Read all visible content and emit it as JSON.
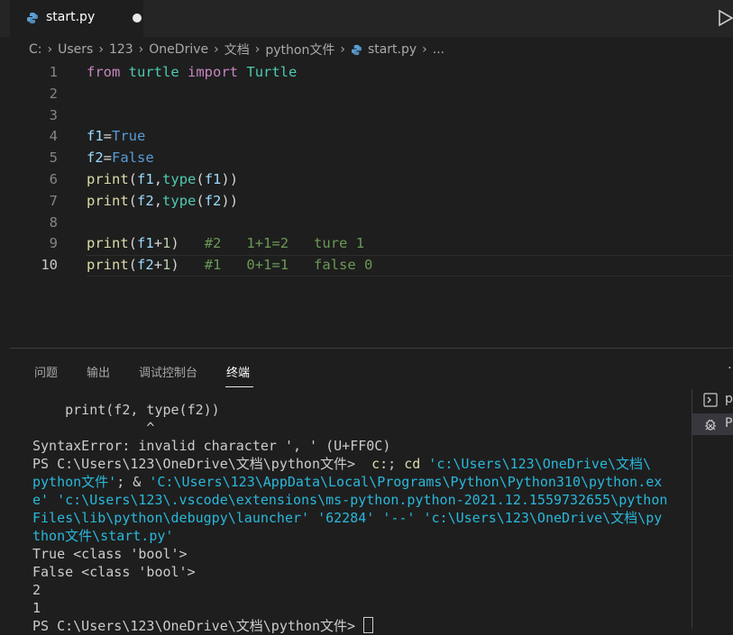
{
  "tab": {
    "filename": "start.py",
    "dirty": true
  },
  "breadcrumb": {
    "items": [
      "C:",
      "Users",
      "123",
      "OneDrive",
      "文档",
      "python文件"
    ],
    "file": "start.py",
    "trail": "..."
  },
  "editor": {
    "lines": [
      {
        "n": "1",
        "tokens": [
          [
            "from",
            "kw"
          ],
          [
            " ",
            "op"
          ],
          [
            "turtle",
            "mod"
          ],
          [
            " ",
            "op"
          ],
          [
            "import",
            "kw"
          ],
          [
            " ",
            "op"
          ],
          [
            "Turtle",
            "cls"
          ]
        ]
      },
      {
        "n": "2",
        "tokens": []
      },
      {
        "n": "3",
        "tokens": []
      },
      {
        "n": "4",
        "tokens": [
          [
            "f1",
            "var"
          ],
          [
            "=",
            "op"
          ],
          [
            "True",
            "const"
          ]
        ]
      },
      {
        "n": "5",
        "tokens": [
          [
            "f2",
            "var"
          ],
          [
            "=",
            "op"
          ],
          [
            "False",
            "const"
          ]
        ]
      },
      {
        "n": "6",
        "tokens": [
          [
            "print",
            "fn"
          ],
          [
            "(",
            "op"
          ],
          [
            "f1",
            "var"
          ],
          [
            ",",
            "op"
          ],
          [
            "type",
            "bfn"
          ],
          [
            "(",
            "op"
          ],
          [
            "f1",
            "var"
          ],
          [
            "))",
            "op"
          ]
        ]
      },
      {
        "n": "7",
        "tokens": [
          [
            "print",
            "fn"
          ],
          [
            "(",
            "op"
          ],
          [
            "f2",
            "var"
          ],
          [
            ",",
            "op"
          ],
          [
            "type",
            "bfn"
          ],
          [
            "(",
            "op"
          ],
          [
            "f2",
            "var"
          ],
          [
            "))",
            "op"
          ]
        ]
      },
      {
        "n": "8",
        "tokens": []
      },
      {
        "n": "9",
        "tokens": [
          [
            "print",
            "fn"
          ],
          [
            "(",
            "op"
          ],
          [
            "f1",
            "var"
          ],
          [
            "+",
            "op"
          ],
          [
            "1",
            "num"
          ],
          [
            ")",
            "op"
          ],
          [
            "   ",
            "op"
          ],
          [
            "#2   1+1=2   ture 1",
            "cmt"
          ]
        ]
      },
      {
        "n": "10",
        "tokens": [
          [
            "print",
            "fn"
          ],
          [
            "(",
            "op"
          ],
          [
            "f2",
            "var"
          ],
          [
            "+",
            "op"
          ],
          [
            "1",
            "num"
          ],
          [
            ")",
            "op"
          ],
          [
            "   ",
            "op"
          ],
          [
            "#1   0+1=1   false 0",
            "cmt"
          ]
        ]
      }
    ],
    "active_line": "10"
  },
  "panel": {
    "tabs": [
      "问题",
      "输出",
      "调试控制台",
      "终端"
    ],
    "active_tab": "终端",
    "more": "…"
  },
  "terminal": {
    "lines": [
      [
        [
          "    print(f2, type(f2))",
          ""
        ]
      ],
      [
        [
          "              ^",
          ""
        ]
      ],
      [
        [
          "SyntaxError: invalid character ', ' (U+FF0C)",
          ""
        ]
      ],
      [
        [
          "PS C:\\Users\\123\\OneDrive\\文档\\python文件>  ",
          ""
        ],
        [
          "c:",
          "t-yellow"
        ],
        [
          "; ",
          ""
        ],
        [
          "cd",
          "t-yellow"
        ],
        [
          " 'c:\\Users\\123\\OneDrive\\文档\\",
          "t-blue"
        ]
      ],
      [
        [
          "python文件'",
          "t-blue"
        ],
        [
          "; & ",
          ""
        ],
        [
          "'C:\\Users\\123\\AppData\\Local\\Programs\\Python\\Python310\\python.ex",
          "t-blue"
        ]
      ],
      [
        [
          "e' 'c:\\Users\\123\\.vscode\\extensions\\ms-python.python-2021.12.1559732655\\python",
          "t-blue"
        ]
      ],
      [
        [
          "Files\\lib\\python\\debugpy\\launcher' '62284' '--' 'c:\\Users\\123\\OneDrive\\文档\\py",
          "t-blue"
        ]
      ],
      [
        [
          "thon文件\\start.py'",
          "t-blue"
        ]
      ],
      [
        [
          "True <class 'bool'>",
          ""
        ]
      ],
      [
        [
          "False <class 'bool'>",
          ""
        ]
      ],
      [
        [
          "2",
          ""
        ]
      ],
      [
        [
          "1",
          ""
        ]
      ],
      [
        [
          "PS C:\\Users\\123\\OneDrive\\文档\\python文件> ",
          ""
        ]
      ]
    ]
  },
  "terminal_list": {
    "items": [
      {
        "label": "p",
        "icon": "terminal-icon",
        "selected": false
      },
      {
        "label": "P",
        "icon": "debug-icon",
        "selected": true
      }
    ]
  }
}
